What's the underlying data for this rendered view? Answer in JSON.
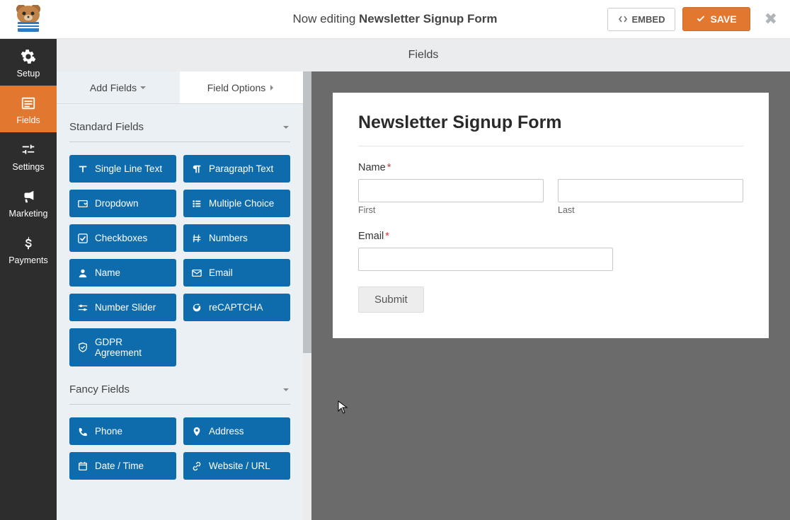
{
  "header": {
    "editing_prefix": "Now editing ",
    "form_name": "Newsletter Signup Form",
    "embed_label": "EMBED",
    "save_label": "SAVE"
  },
  "sidebar": {
    "items": [
      {
        "label": "Setup",
        "icon": "gear"
      },
      {
        "label": "Fields",
        "icon": "list"
      },
      {
        "label": "Settings",
        "icon": "sliders"
      },
      {
        "label": "Marketing",
        "icon": "bullhorn"
      },
      {
        "label": "Payments",
        "icon": "dollar"
      }
    ]
  },
  "center_header": "Fields",
  "fields_panel": {
    "tabs": {
      "add": "Add Fields",
      "options": "Field Options"
    },
    "sections": [
      {
        "title": "Standard Fields",
        "items": [
          {
            "label": "Single Line Text",
            "icon": "text"
          },
          {
            "label": "Paragraph Text",
            "icon": "paragraph"
          },
          {
            "label": "Dropdown",
            "icon": "dropdown"
          },
          {
            "label": "Multiple Choice",
            "icon": "list-ul"
          },
          {
            "label": "Checkboxes",
            "icon": "check"
          },
          {
            "label": "Numbers",
            "icon": "hash"
          },
          {
            "label": "Name",
            "icon": "user"
          },
          {
            "label": "Email",
            "icon": "envelope"
          },
          {
            "label": "Number Slider",
            "icon": "sliders-h"
          },
          {
            "label": "reCAPTCHA",
            "icon": "google"
          },
          {
            "label": "GDPR Agreement",
            "icon": "shield"
          }
        ]
      },
      {
        "title": "Fancy Fields",
        "items": [
          {
            "label": "Phone",
            "icon": "phone"
          },
          {
            "label": "Address",
            "icon": "pin"
          },
          {
            "label": "Date / Time",
            "icon": "calendar"
          },
          {
            "label": "Website / URL",
            "icon": "link"
          }
        ]
      }
    ]
  },
  "preview": {
    "form_title": "Newsletter Signup Form",
    "name_label": "Name",
    "first_label": "First",
    "last_label": "Last",
    "email_label": "Email",
    "submit_label": "Submit"
  }
}
